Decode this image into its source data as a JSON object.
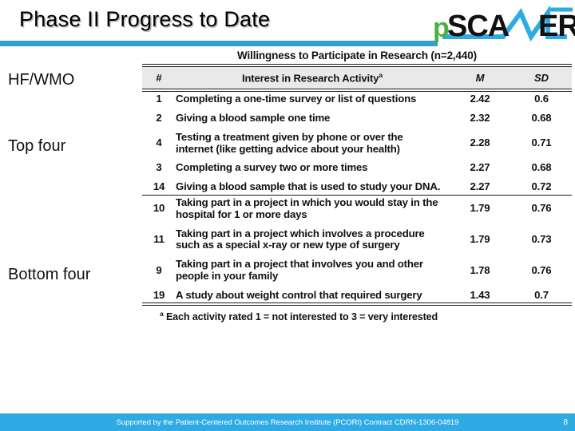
{
  "header": {
    "title": "Phase II Progress to Date",
    "rule_color": "#32A0CC",
    "logo": {
      "name": "pscanner-logo",
      "part_p": "p",
      "part_sca": "SCA",
      "part_nn": "NN",
      "part_er": "ER",
      "green": "#4CAF3F",
      "blue": "#2EAAE4",
      "black": "#111111"
    }
  },
  "left_labels": {
    "hfwmo": "HF/WMO",
    "top_four": "Top four",
    "bottom_four": "Bottom four"
  },
  "table": {
    "caption": "Willingness to Participate in Research (n=2,440)",
    "columns": {
      "num": "#",
      "activity": "Interest in Research Activity",
      "activity_sup": "a",
      "m": "M",
      "sd": "SD"
    },
    "top_rows": [
      {
        "num": "1",
        "activity": "Completing a one-time survey or list of questions",
        "m": "2.42",
        "sd": "0.6"
      },
      {
        "num": "2",
        "activity": "Giving a blood sample one time",
        "m": "2.32",
        "sd": "0.68"
      },
      {
        "num": "4",
        "activity": "Testing a treatment given by phone or over the internet (like getting advice about your health)",
        "m": "2.28",
        "sd": "0.71"
      },
      {
        "num": "3",
        "activity": "Completing a survey two or more times",
        "m": "2.27",
        "sd": "0.68"
      },
      {
        "num": "14",
        "activity": "Giving a blood sample that is used to study your DNA.",
        "m": "2.27",
        "sd": "0.72"
      }
    ],
    "bottom_rows": [
      {
        "num": "10",
        "activity": "Taking part in a project in which you would stay in the hospital for 1 or more days",
        "m": "1.79",
        "sd": "0.76"
      },
      {
        "num": "11",
        "activity": "Taking part in a project which involves a procedure such as a special x-ray or new type of surgery",
        "m": "1.79",
        "sd": "0.73"
      },
      {
        "num": "9",
        "activity": "Taking part in a project that involves you and other people in your family",
        "m": "1.78",
        "sd": "0.76"
      },
      {
        "num": "19",
        "activity": "A study about weight control that required surgery",
        "m": "1.43",
        "sd": "0.7"
      }
    ],
    "footnote_sup": "a",
    "footnote": "Each activity rated 1 = not interested to 3 = very interested",
    "header_bg": "#E9E9E9"
  },
  "footer": {
    "text": "Supported by the Patient-Centered Outcomes Research Institute (PCORI) Contract CDRN-1306-04819",
    "page_number": "8",
    "bg_color": "#2EAAE4"
  }
}
